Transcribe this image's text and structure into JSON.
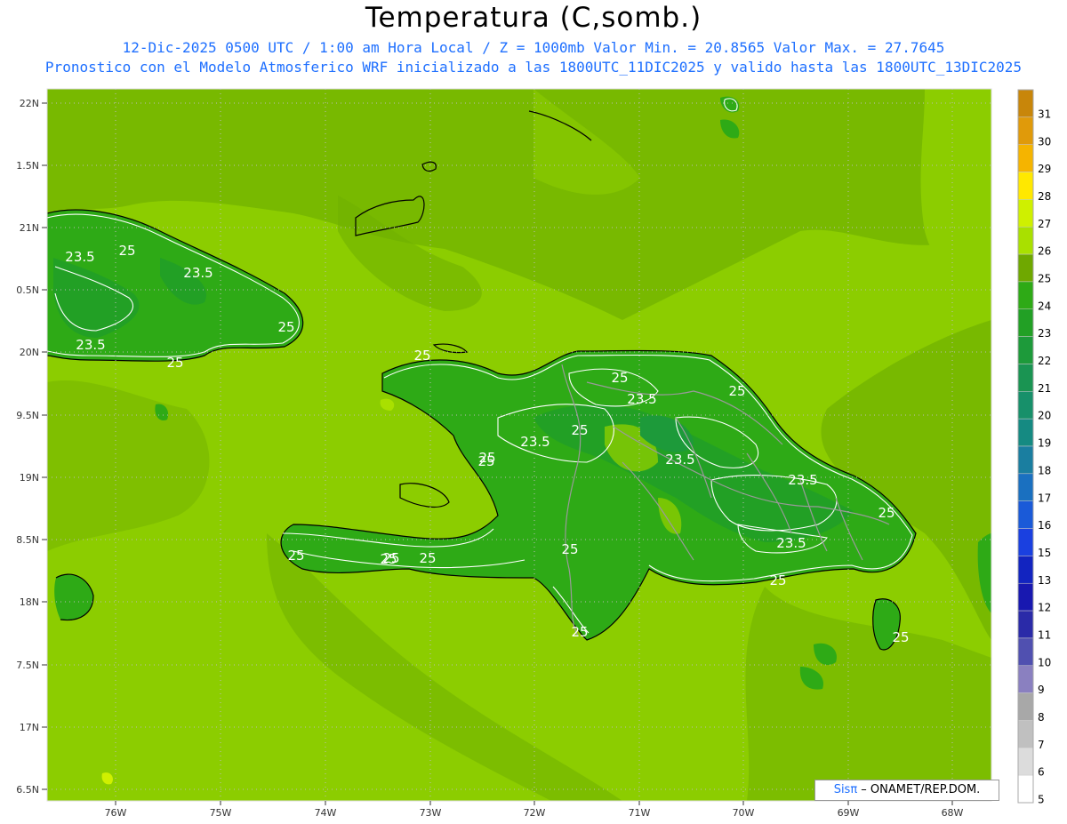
{
  "title": "Temperatura (C,somb.)",
  "subtitle_line1": "12-Dic-2025  0500 UTC / 1:00 am Hora Local / Z = 1000mb   Valor Min. = 20.8565  Valor Max. = 27.7645",
  "subtitle_line2": "Pronostico con el Modelo Atmosferico WRF inicializado a las 1800UTC_11DIC2025 y valido hasta las  1800UTC_13DIC2025",
  "lat_ticks": [
    "22N",
    "1.5N",
    "21N",
    "0.5N",
    "20N",
    "9.5N",
    "19N",
    "8.5N",
    "18N",
    "7.5N",
    "17N",
    "6.5N"
  ],
  "lon_ticks": [
    "76W",
    "75W",
    "74W",
    "73W",
    "72W",
    "71W",
    "70W",
    "69W",
    "68W"
  ],
  "colorbar": {
    "labels": [
      "31",
      "30",
      "29",
      "28",
      "27",
      "26",
      "25",
      "24",
      "23",
      "22",
      "21",
      "20",
      "19",
      "18",
      "17",
      "16",
      "15",
      "13",
      "12",
      "11",
      "10",
      "9",
      "8",
      "7",
      "6",
      "5"
    ],
    "colors": [
      "#c8860a",
      "#e09a0a",
      "#f5b400",
      "#ffe800",
      "#cff000",
      "#a9e000",
      "#6fa800",
      "#2eaa16",
      "#22a025",
      "#1d9a3a",
      "#1a9452",
      "#17906a",
      "#158a82",
      "#1a7ea0",
      "#1a70c0",
      "#1a5ad8",
      "#1a40e0",
      "#1224c0",
      "#1818b0",
      "#2a2aa8",
      "#5050b0",
      "#8a80c0",
      "#a8a8a8",
      "#c0c0c0",
      "#dcdcdc",
      "#ffffff"
    ]
  },
  "contour_labels": [
    "25",
    "23.5",
    "23.5",
    "23.5",
    "25",
    "25",
    "25",
    "23.5",
    "25",
    "23.5",
    "25",
    "25",
    "23.5",
    "25",
    "23.5",
    "23.5",
    "25",
    "25",
    "25",
    "25",
    "25",
    "25",
    "25",
    "25",
    "25",
    "25"
  ],
  "credit": {
    "brand": "Sisπ",
    "text": " – ONAMET/REP.DOM."
  }
}
